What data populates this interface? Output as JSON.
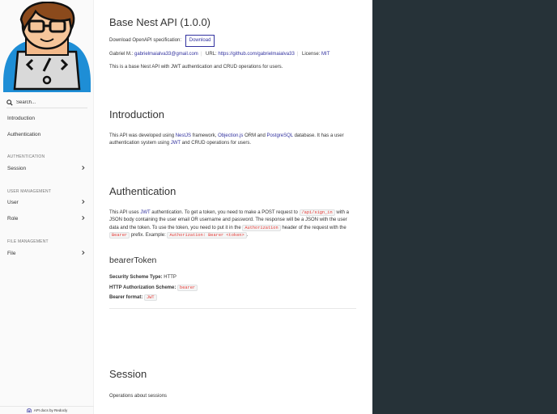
{
  "sidebar": {
    "search_placeholder": "Search...",
    "top_items": [
      "Introduction",
      "Authentication"
    ],
    "sections": [
      {
        "title": "AUTHENTICATION",
        "items": [
          "Session"
        ]
      },
      {
        "title": "USER MANAGEMENT",
        "items": [
          "User",
          "Role"
        ]
      },
      {
        "title": "FILE MANAGEMENT",
        "items": [
          "File"
        ]
      }
    ],
    "footer": "API docs by Redocly"
  },
  "header": {
    "title": "Base Nest API (1.0.0)",
    "download_label": "Download OpenAPI specification:",
    "download_button": "Download",
    "contact_name": "Gabriel M.:",
    "contact_email": "gabrielmaialva33@gmail.com",
    "url_label": "URL:",
    "url_value": "https://github.com/gabrielmaialva33",
    "license_label": "License:",
    "license_value": "MIT",
    "description": "This is a base Nest API with JWT authentication and CRUD operations for users."
  },
  "introduction": {
    "title": "Introduction",
    "t1": "This API was developed using ",
    "l1": "NestJS",
    "t2": " framework, ",
    "l2": "Objection.js",
    "t3": " ORM and ",
    "l3": "PostgreSQL",
    "t4": " database. It has a user authentication system using ",
    "l4": "JWT",
    "t5": " and CRUD operations for users."
  },
  "authentication": {
    "title": "Authentication",
    "t1": "This API uses ",
    "l1": "JWT",
    "t2": " authentication. To get a token, you need to make a POST request to ",
    "c1": "/api/sign_in",
    "t3": " with a JSON body containing the user email OR username and password. The response will be a JSON with the user data and the token. To use the token, you need to put it in the ",
    "c2": "Authorization",
    "t4": " header of the request with the ",
    "c3": "Bearer",
    "t5": " prefix. Example: ",
    "c4": "Authorization: Bearer <token>",
    "t6": ".",
    "scheme_title": "bearerToken",
    "type_label": "Security Scheme Type:",
    "type_value": "HTTP",
    "http_label": "HTTP Authorization Scheme:",
    "http_value": "bearer",
    "format_label": "Bearer format:",
    "format_value": "JWT"
  },
  "session": {
    "title": "Session",
    "description": "Operations about sessions"
  },
  "colors": {
    "accent": "#32329f",
    "code_text": "#e53935",
    "right_panel": "#263238"
  }
}
